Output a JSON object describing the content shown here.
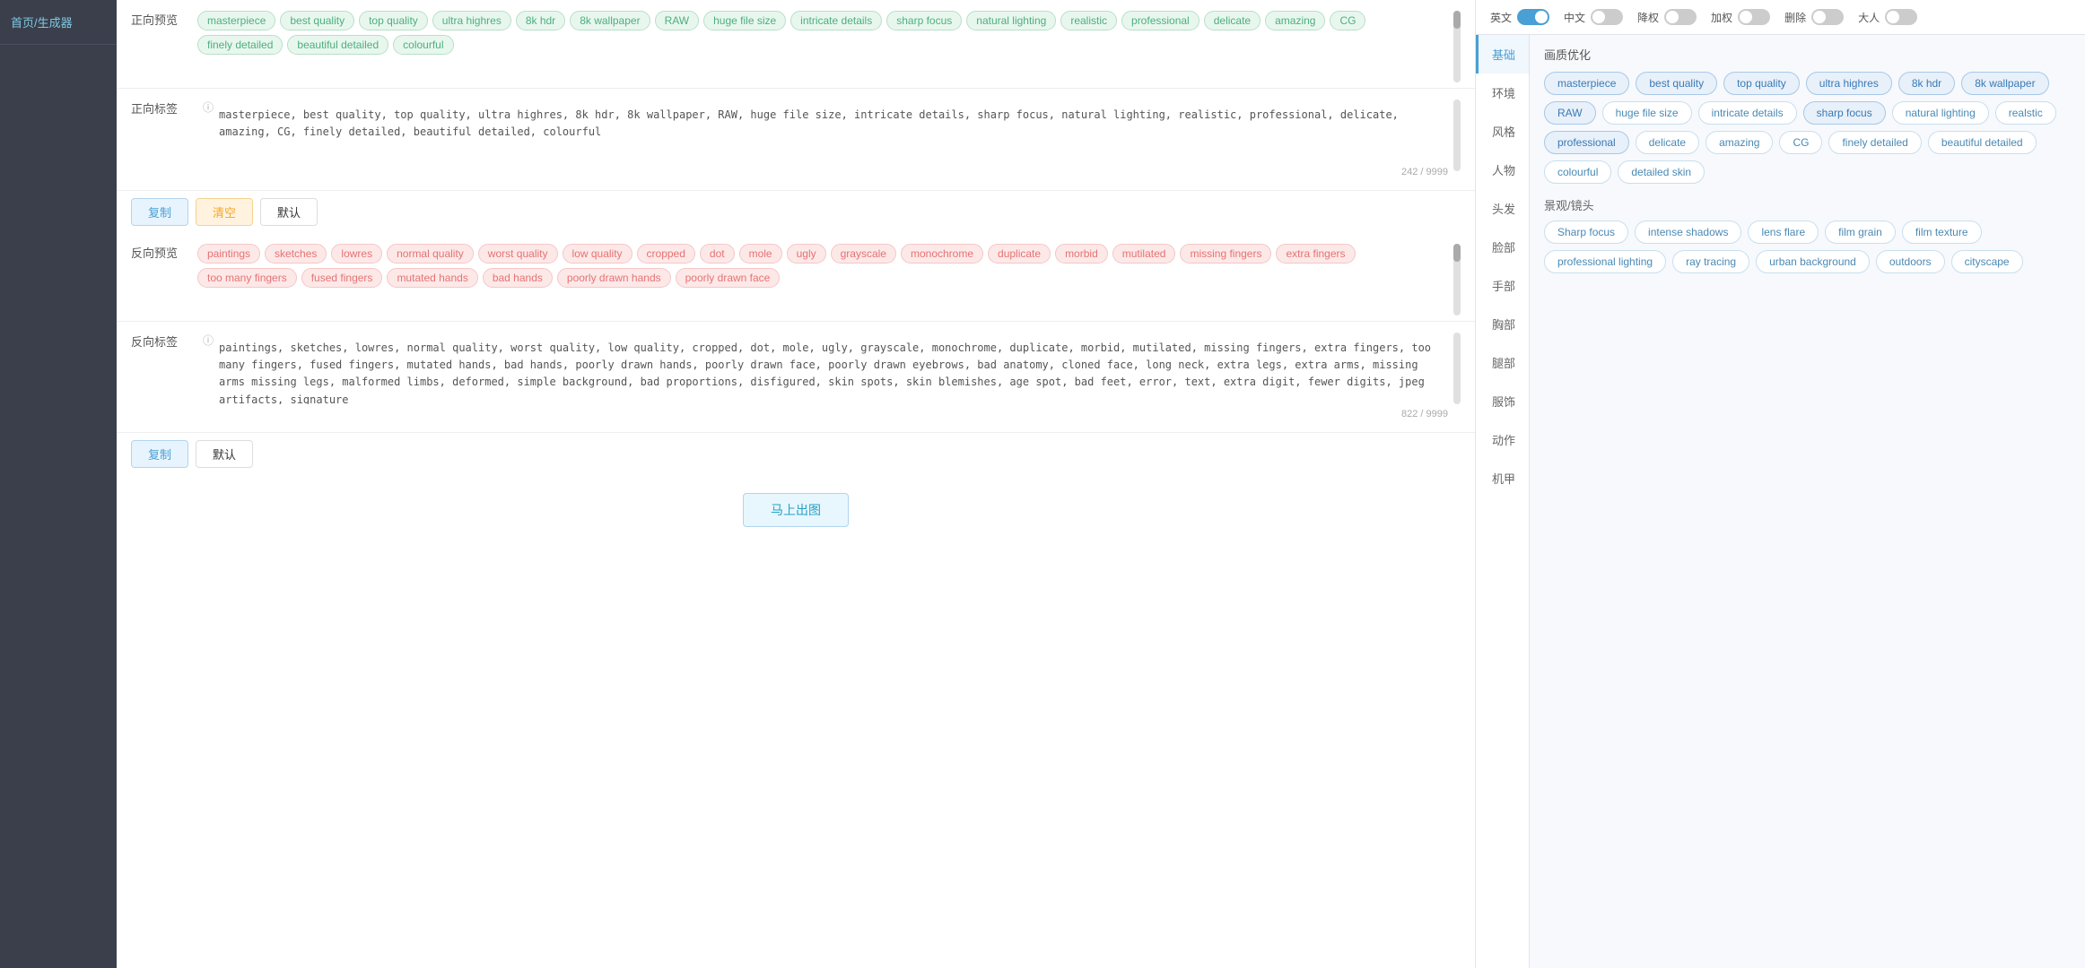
{
  "sidebar": {
    "logo": "首页/生成器"
  },
  "toggles": {
    "english_label": "英文",
    "english_on": true,
    "chinese_label": "中文",
    "chinese_on": false,
    "downweight_label": "降权",
    "downweight_on": false,
    "upweight_label": "加权",
    "upweight_on": false,
    "delete_label": "删除",
    "delete_on": false,
    "adult_label": "大人",
    "adult_on": false
  },
  "positive_preview": {
    "label": "正向预览",
    "tags_row1": [
      "masterpiece",
      "best quality",
      "top quality",
      "ultra highres",
      "8k hdr",
      "8k wallpaper",
      "RAW",
      "huge file size"
    ],
    "tags_row2": [
      "intricate details",
      "sharp focus",
      "natural lighting",
      "realistic",
      "professional",
      "delicate",
      "amazing",
      "CG"
    ],
    "tags_row3": [
      "finely detailed",
      "beautiful detailed",
      "colourful"
    ]
  },
  "positive_label": {
    "label": "正向标签",
    "text": "masterpiece, best quality, top quality, ultra highres, 8k hdr, 8k wallpaper, RAW, huge file size, intricate details, sharp focus, natural lighting, realistic, professional, delicate, amazing, CG, finely detailed, beautiful detailed, colourful",
    "char_count": "242 / 9999"
  },
  "positive_actions": {
    "copy": "复制",
    "clear": "清空",
    "default": "默认"
  },
  "negative_preview": {
    "label": "反向预览",
    "tags_row1": [
      "paintings",
      "sketches",
      "lowres",
      "normal quality",
      "worst quality",
      "low quality",
      "cropped",
      "dot",
      "mole"
    ],
    "tags_row2": [
      "ugly",
      "grayscale",
      "monochrome",
      "duplicate",
      "morbid",
      "mutilated",
      "missing fingers",
      "extra fingers"
    ],
    "tags_row3": [
      "too many fingers",
      "fused fingers",
      "mutated hands",
      "bad hands",
      "poorly drawn hands",
      "poorly drawn face"
    ]
  },
  "negative_label": {
    "label": "反向标签",
    "text": "paintings, sketches, lowres, normal quality, worst quality, low quality, cropped, dot, mole, ugly, grayscale, monochrome, duplicate, morbid, mutilated, missing fingers, extra fingers, too many fingers, fused fingers, mutated hands, bad hands, poorly drawn hands, poorly drawn face, poorly drawn eyebrows, bad anatomy, cloned face, long neck, extra legs, extra arms, missing arms missing legs, malformed limbs, deformed, simple background, bad proportions, disfigured, skin spots, skin blemishes, age spot, bad feet, error, text, extra digit, fewer digits, jpeg artifacts, signature",
    "char_count": "822 / 9999"
  },
  "negative_actions": {
    "copy": "复制",
    "default": "默认"
  },
  "generate_button": "马上出图",
  "categories": [
    {
      "id": "basic",
      "label": "基础",
      "active": true
    },
    {
      "id": "environment",
      "label": "环境"
    },
    {
      "id": "style",
      "label": "风格"
    },
    {
      "id": "character",
      "label": "人物"
    },
    {
      "id": "hair",
      "label": "头发"
    },
    {
      "id": "face",
      "label": "脸部"
    },
    {
      "id": "hands",
      "label": "手部"
    },
    {
      "id": "chest",
      "label": "胸部"
    },
    {
      "id": "legs",
      "label": "腿部"
    },
    {
      "id": "clothing",
      "label": "服饰"
    },
    {
      "id": "action",
      "label": "动作"
    },
    {
      "id": "mech",
      "label": "机甲"
    }
  ],
  "tag_panel": {
    "quality_title": "画质优化",
    "quality_tags": [
      "masterpiece",
      "best quality",
      "top quality",
      "ultra highres",
      "8k hdr",
      "8k wallpaper",
      "RAW",
      "huge file size",
      "intricate details",
      "sharp focus",
      "natural lighting",
      "realstic",
      "professional",
      "delicate",
      "amazing",
      "CG",
      "finely detailed",
      "beautiful detailed",
      "colourful",
      "detailed skin"
    ],
    "lens_title": "景观/镜头",
    "lens_tags": [
      "Sharp focus",
      "intense shadows",
      "lens flare",
      "film grain",
      "film texture",
      "professional lighting",
      "ray tracing",
      "urban background",
      "outdoors",
      "cityscape"
    ],
    "highlighted_quality": [
      "masterpiece",
      "best quality",
      "top quality",
      "ultra highres",
      "8k hdr",
      "8k wallpaper",
      "RAW"
    ],
    "highlighted_lens": [
      "sharp focus",
      "professional"
    ]
  }
}
